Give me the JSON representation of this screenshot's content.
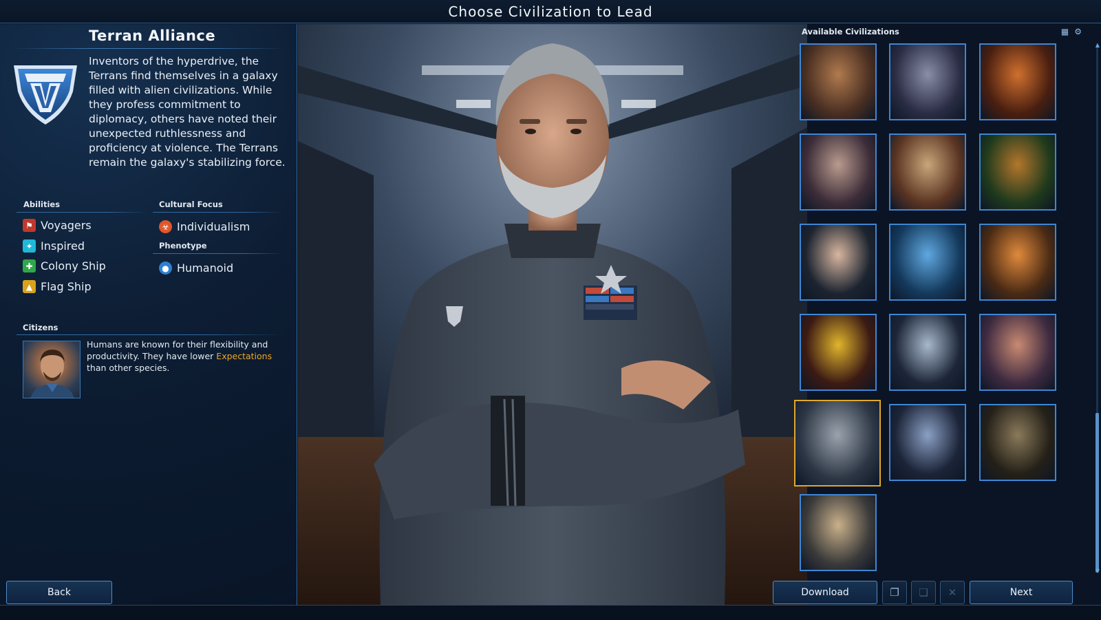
{
  "header": {
    "title": "Choose Civilization to Lead"
  },
  "civ": {
    "name": "Terran Alliance",
    "description": "Inventors of the hyperdrive, the Terrans find themselves in a galaxy filled with alien civilizations. While they profess commitment to diplomacy, others have noted their unexpected ruthlessness and proficiency at violence. The Terrans remain the galaxy's stabilizing force."
  },
  "abilities": {
    "heading": "Abilities",
    "items": [
      {
        "label": "Voyagers",
        "icon": "voyagers-icon",
        "color": "#c0392b"
      },
      {
        "label": "Inspired",
        "icon": "inspired-icon",
        "color": "#1fb8d6"
      },
      {
        "label": "Colony Ship",
        "icon": "colony-ship-icon",
        "color": "#2ea84a"
      },
      {
        "label": "Flag Ship",
        "icon": "flag-ship-icon",
        "color": "#d9a21c"
      }
    ]
  },
  "cultural_focus": {
    "heading": "Cultural Focus",
    "label": "Individualism",
    "icon": "individualism-icon",
    "color": "#e0562a"
  },
  "phenotype": {
    "heading": "Phenotype",
    "label": "Humanoid",
    "icon": "humanoid-icon",
    "color": "#2f7fd0"
  },
  "citizens": {
    "heading": "Citizens",
    "text_before": "Humans are known for their flexibility and productivity. They have lower ",
    "keyword": "Expectations",
    "text_after": " than other species.",
    "keyword_color": "#f2a623"
  },
  "civ_grid": {
    "heading": "Available Civilizations",
    "tool_icons": [
      "grid-view-icon",
      "settings-icon"
    ],
    "portraits": [
      {
        "name": "civ-portrait-1",
        "colors": [
          "#b07a4e",
          "#4a2f22"
        ]
      },
      {
        "name": "civ-portrait-2",
        "colors": [
          "#8a8ea8",
          "#2a2d44"
        ]
      },
      {
        "name": "civ-portrait-3",
        "colors": [
          "#d0702e",
          "#4a1f10"
        ]
      },
      {
        "name": "civ-portrait-4",
        "colors": [
          "#b99b8e",
          "#3c2c38"
        ]
      },
      {
        "name": "civ-portrait-5",
        "colors": [
          "#c9a67a",
          "#5a3422"
        ]
      },
      {
        "name": "civ-portrait-6",
        "colors": [
          "#b4762c",
          "#1f3a1c"
        ]
      },
      {
        "name": "civ-portrait-7",
        "colors": [
          "#d8b6a0",
          "#1c2430"
        ]
      },
      {
        "name": "civ-portrait-8",
        "colors": [
          "#5fa8e0",
          "#14395c"
        ]
      },
      {
        "name": "civ-portrait-9",
        "colors": [
          "#e08a3c",
          "#4a2a14"
        ]
      },
      {
        "name": "civ-portrait-10",
        "colors": [
          "#e0b52c",
          "#3c1a14"
        ]
      },
      {
        "name": "civ-portrait-11",
        "colors": [
          "#a9b8cc",
          "#1c2638"
        ]
      },
      {
        "name": "civ-portrait-12",
        "colors": [
          "#c98a72",
          "#3e2a40"
        ]
      },
      {
        "name": "civ-portrait-13",
        "colors": [
          "#9aa3ad",
          "#2d3644"
        ],
        "selected": true
      },
      {
        "name": "civ-portrait-14",
        "colors": [
          "#8aa0c4",
          "#1c2438"
        ]
      },
      {
        "name": "civ-portrait-15",
        "colors": [
          "#8a7a5a",
          "#242018"
        ]
      },
      {
        "name": "civ-portrait-16",
        "colors": [
          "#c9b08a",
          "#3a3a3a"
        ]
      }
    ]
  },
  "buttons": {
    "back": "Back",
    "download": "Download",
    "next": "Next"
  },
  "toolbar_icons": [
    "copy-icon",
    "paste-icon",
    "delete-icon"
  ]
}
